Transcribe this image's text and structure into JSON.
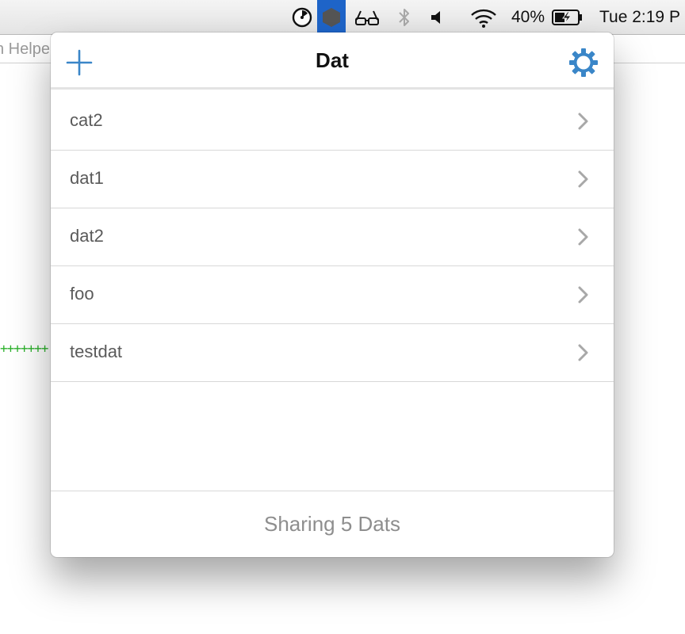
{
  "menubar": {
    "battery_percent": "40%",
    "clock": "Tue 2:19 P",
    "icons": [
      "timer-icon",
      "dat-app-icon",
      "glasses-icon",
      "bluetooth-icon",
      "volume-icon",
      "wifi-icon",
      "battery-charging-icon"
    ],
    "active_color": "#1e64c8"
  },
  "background": {
    "window_title_fragment": "n Helpe",
    "terminal_fragment": "+++++++"
  },
  "popover": {
    "title": "Dat",
    "add_icon": "plus-icon",
    "settings_icon": "gear-icon",
    "accent_color": "#3a86c8",
    "items": [
      {
        "label": "cat2"
      },
      {
        "label": "dat1"
      },
      {
        "label": "dat2"
      },
      {
        "label": "foo"
      },
      {
        "label": "testdat"
      }
    ],
    "footer": "Sharing 5 Dats"
  }
}
